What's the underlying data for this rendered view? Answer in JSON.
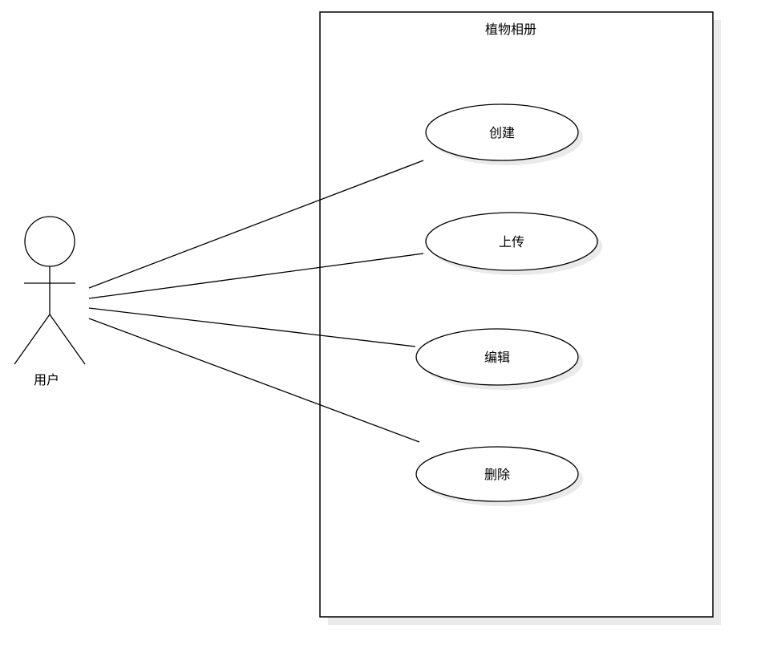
{
  "system": {
    "title": "植物相册"
  },
  "actor": {
    "label": "用户"
  },
  "use_cases": [
    {
      "id": "create",
      "label": "创建"
    },
    {
      "id": "upload",
      "label": "上传"
    },
    {
      "id": "edit",
      "label": "编辑"
    },
    {
      "id": "delete",
      "label": "删除"
    }
  ],
  "associations": [
    {
      "from": "actor",
      "to": "create"
    },
    {
      "from": "actor",
      "to": "upload"
    },
    {
      "from": "actor",
      "to": "edit"
    },
    {
      "from": "actor",
      "to": "delete"
    }
  ]
}
